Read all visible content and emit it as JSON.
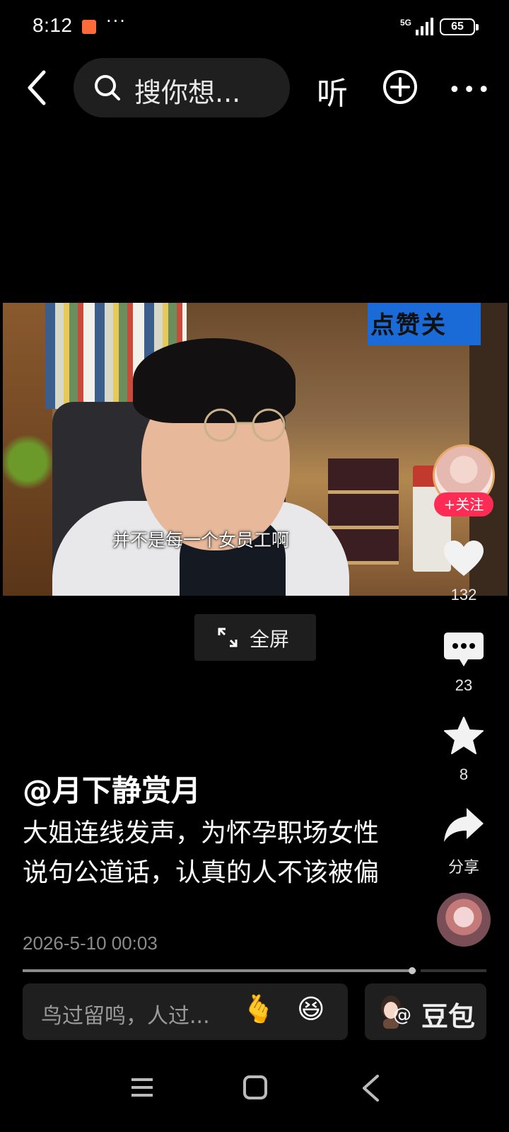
{
  "status_bar": {
    "time": "8:12",
    "more": "···",
    "network": "5G",
    "battery": "65"
  },
  "top_bar": {
    "search_placeholder": "搜你想...",
    "listen_label": "听"
  },
  "video": {
    "subtitle": "并不是每一个女员工啊",
    "banner_text": "点赞关",
    "fullscreen_label": "全屏"
  },
  "right_rail": {
    "follow_label": "+关注",
    "likes": "132",
    "comments": "23",
    "favorites": "8",
    "share_label": "分享"
  },
  "post": {
    "author": "@月下静赏月",
    "description": "大姐连线发声，为怀孕职场女性说句公道话，认真的人不该被偏",
    "date": "2026-5-10 00:03",
    "progress": 0.84
  },
  "bottom": {
    "comment_placeholder": "鸟过留鸣，人过...",
    "emoji_heart": "🫰",
    "emoji_grin": "😆",
    "doubao_label": "豆包",
    "doubao_at": "@"
  },
  "colors": {
    "follow": "#fe2c55",
    "background": "#000000"
  }
}
